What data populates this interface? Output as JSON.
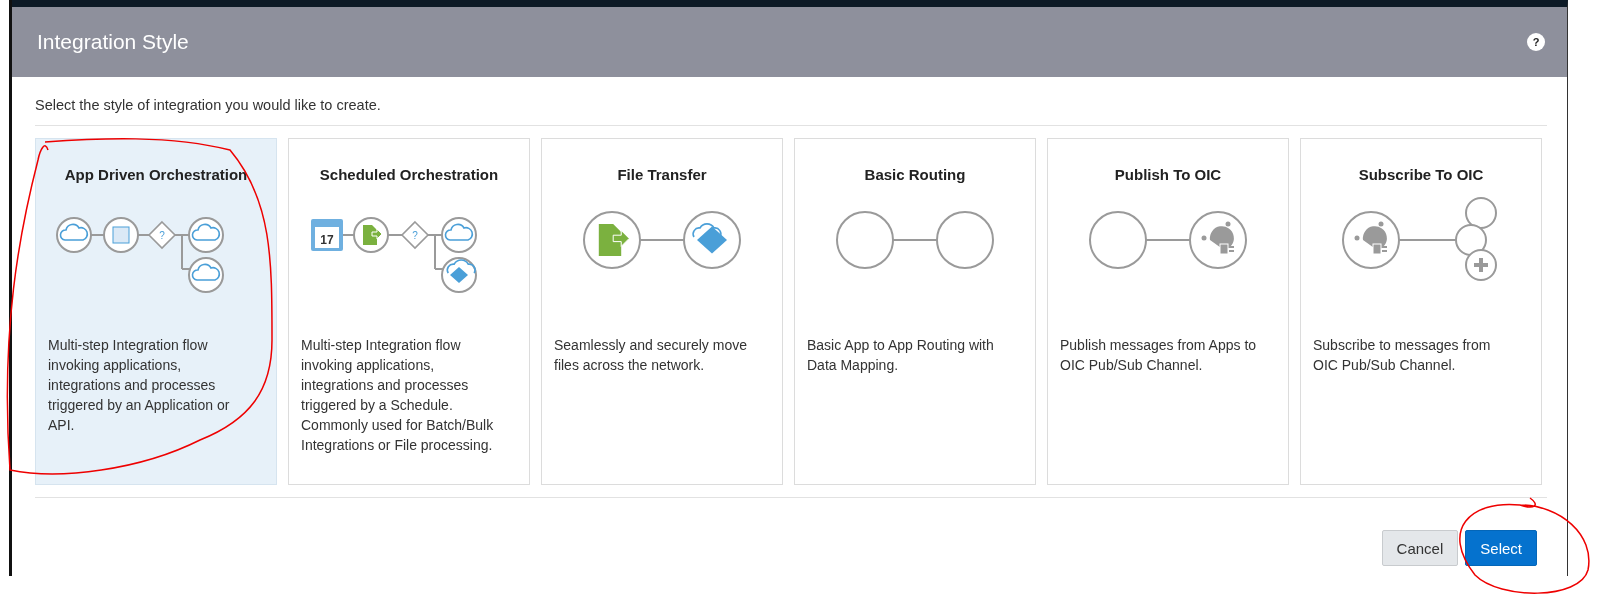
{
  "dialog": {
    "title": "Integration Style",
    "help": "?",
    "instruction": "Select the style of integration you would like to create.",
    "styles": [
      {
        "kind": "app_driven",
        "title": "App Driven Orchestration",
        "description": "Multi-step Integration flow invoking applications, integrations and processes triggered by an Application or API.",
        "selected": true,
        "decision_mark": "?"
      },
      {
        "kind": "scheduled",
        "title": "Scheduled Orchestration",
        "description": "Multi-step Integration flow invoking applications, integrations and processes triggered by a Schedule. Commonly used for Batch/Bulk Integrations or File processing.",
        "selected": false,
        "calendar_day": "17",
        "decision_mark": "?"
      },
      {
        "kind": "file_transfer",
        "title": "File Transfer",
        "description": "Seamlessly and securely move files across the network.",
        "selected": false
      },
      {
        "kind": "basic_routing",
        "title": "Basic Routing",
        "description": "Basic App to App Routing with Data Mapping.",
        "selected": false
      },
      {
        "kind": "publish",
        "title": "Publish To OIC",
        "description": "Publish messages from Apps to OIC Pub/Sub Channel.",
        "selected": false
      },
      {
        "kind": "subscribe",
        "title": "Subscribe To OIC",
        "description": "Subscribe to messages from OIC Pub/Sub Channel.",
        "selected": false
      }
    ],
    "buttons": [
      {
        "label": "Cancel",
        "kind": "secondary"
      },
      {
        "label": "Select",
        "kind": "primary"
      }
    ]
  }
}
